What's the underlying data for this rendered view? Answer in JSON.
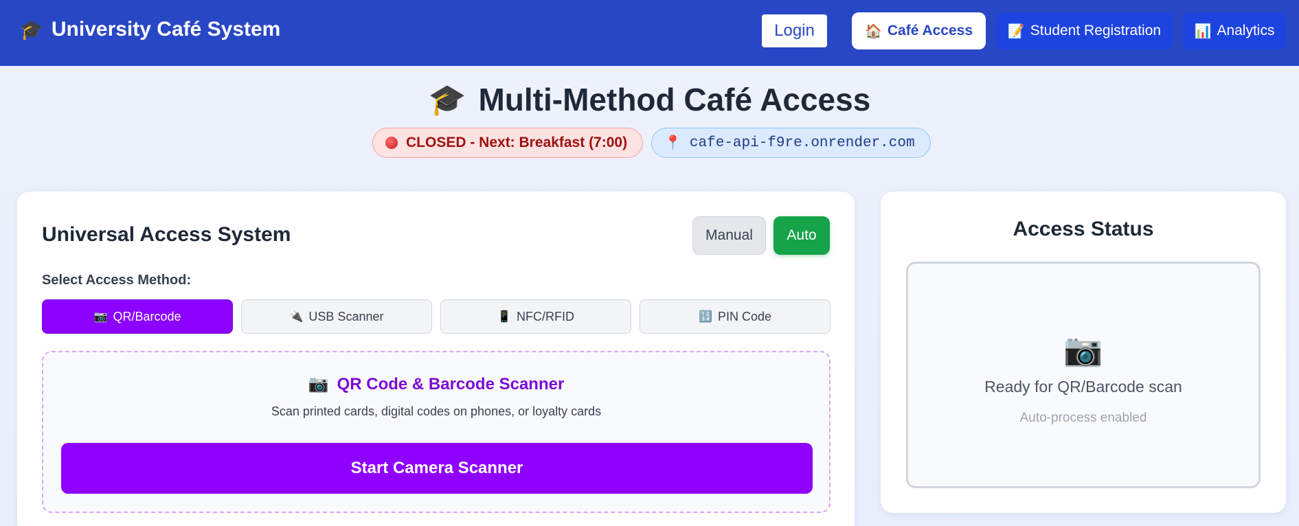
{
  "header": {
    "brand_icon": "graduation-cap-icon",
    "brand_icon_glyph": "🎓",
    "title": "University Café System",
    "login_label": "Login",
    "nav": [
      {
        "icon": "house-icon",
        "glyph": "🏠",
        "label": "Café Access",
        "active": true
      },
      {
        "icon": "memo-icon",
        "glyph": "📝",
        "label": "Student Registration",
        "active": false
      },
      {
        "icon": "bar-chart-icon",
        "glyph": "📊",
        "label": "Analytics",
        "active": false
      }
    ]
  },
  "page": {
    "title_icon_glyph": "🎓",
    "title": "Multi-Method Café Access",
    "status_text": "CLOSED - Next: Breakfast (7:00)",
    "host_icon_glyph": "📍",
    "host": "cafe-api-f9re.onrender.com"
  },
  "access": {
    "title": "Universal Access System",
    "mode_manual": "Manual",
    "mode_auto": "Auto",
    "active_mode": "Auto",
    "method_label": "Select Access Method:",
    "methods": [
      {
        "icon": "camera-icon",
        "glyph": "📷",
        "label": "QR/Barcode",
        "active": true
      },
      {
        "icon": "usb-icon",
        "glyph": "🔌",
        "label": "USB Scanner",
        "active": false
      },
      {
        "icon": "phone-icon",
        "glyph": "📱",
        "label": "NFC/RFID",
        "active": false
      },
      {
        "icon": "numbers-icon",
        "glyph": "🔢",
        "label": "PIN Code",
        "active": false
      }
    ],
    "scanner": {
      "icon_glyph": "📷",
      "title": "QR Code & Barcode Scanner",
      "subtitle": "Scan printed cards, digital codes on phones, or loyalty cards",
      "button": "Start Camera Scanner"
    }
  },
  "status": {
    "title": "Access Status",
    "icon_glyph": "📷",
    "message": "Ready for QR/Barcode scan",
    "sub": "Auto-process enabled"
  },
  "colors": {
    "header": "#2847c4",
    "accent_purple": "#9000ff",
    "auto_green": "#16a34a",
    "closed_red": "#a01010"
  }
}
